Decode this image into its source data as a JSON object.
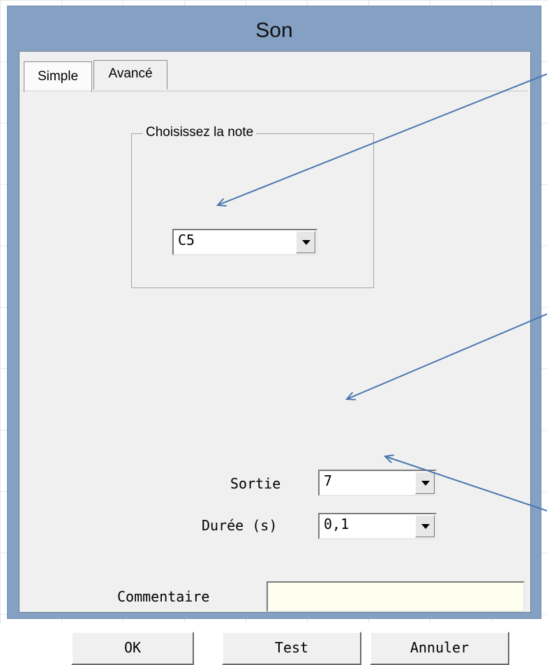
{
  "window": {
    "title": "Son"
  },
  "tabs": [
    {
      "label": "Simple",
      "active": true
    },
    {
      "label": "Avancé",
      "active": false
    }
  ],
  "note_group": {
    "legend": "Choisissez la note",
    "note_select": {
      "value": "C5"
    }
  },
  "sortie": {
    "label": "Sortie",
    "value": "7"
  },
  "duree": {
    "label": "Durée (s)",
    "value": "0,1"
  },
  "commentaire": {
    "label": "Commentaire",
    "value": ""
  },
  "buttons": {
    "ok": "OK",
    "test": "Test",
    "annuler": "Annuler"
  },
  "colors": {
    "title_bar": "#84a1c3",
    "annotation_arrow": "#4a76b0",
    "comment_field_bg": "#fffff0"
  }
}
